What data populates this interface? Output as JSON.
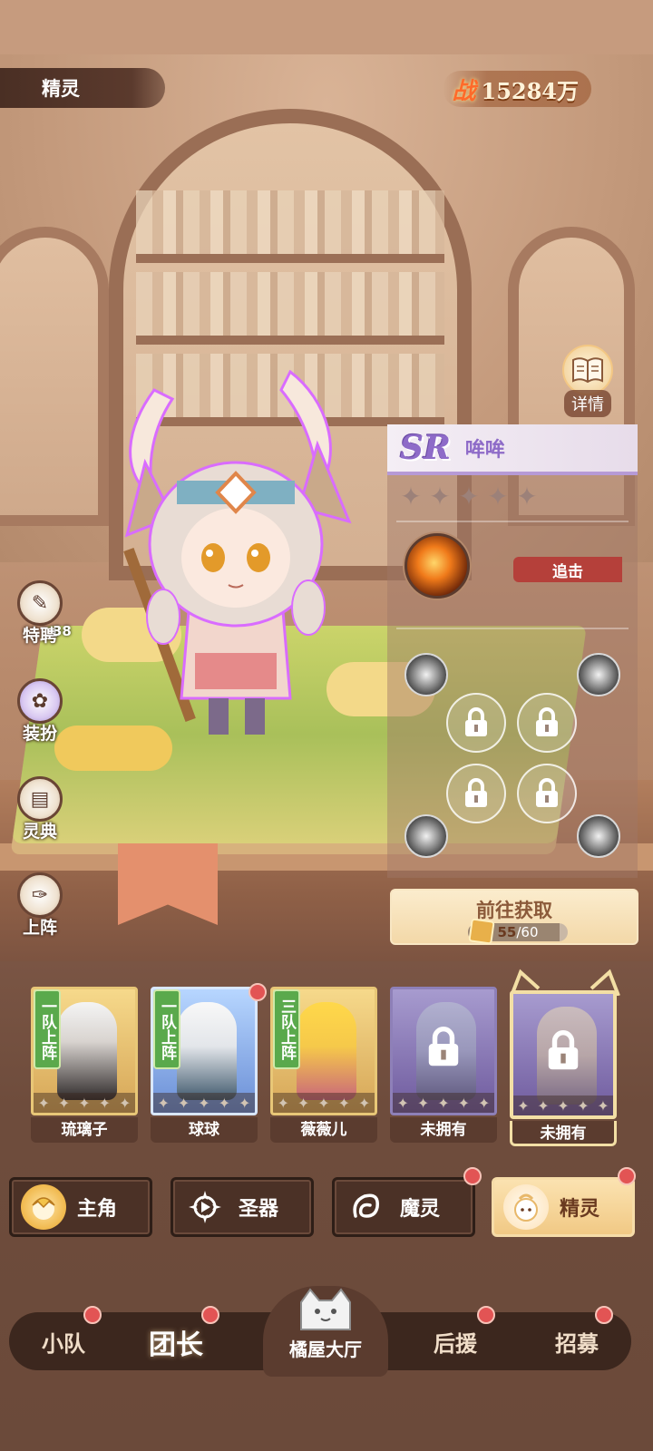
{
  "header": {
    "title": "精灵",
    "power_icon": "战",
    "power_value": "15284万"
  },
  "details_button": {
    "label": "详情",
    "icon": "book-icon"
  },
  "character": {
    "rarity": "SR",
    "name": "哞哞",
    "stars_total": 5,
    "stars_filled": 0,
    "skill": {
      "icon": "fire-meteor-icon",
      "tag": "追击"
    },
    "rune_slots_locked": 4,
    "obtain": {
      "label": "前往获取",
      "current": "55",
      "required": "/60",
      "progress": 0.9167
    }
  },
  "side_menu": [
    {
      "label": "特聘",
      "icon": "scroll-icon",
      "badge": "38"
    },
    {
      "label": "装扮",
      "icon": "outfit-icon"
    },
    {
      "label": "灵典",
      "icon": "codex-icon"
    },
    {
      "label": "上阵",
      "icon": "deploy-icon"
    }
  ],
  "roster": [
    {
      "name": "琉璃子",
      "team_tag": "一队上阵",
      "owned": true,
      "style": "gold",
      "red_dot": false
    },
    {
      "name": "球球",
      "team_tag": "一队上阵",
      "owned": true,
      "style": "blue",
      "red_dot": true
    },
    {
      "name": "薇薇儿",
      "team_tag": "三队上阵",
      "owned": true,
      "style": "gold",
      "red_dot": false
    },
    {
      "name": "未拥有",
      "team_tag": "",
      "owned": false,
      "style": "locked",
      "red_dot": false
    },
    {
      "name": "未拥有",
      "team_tag": "",
      "owned": false,
      "style": "locked",
      "red_dot": false,
      "selected": true
    }
  ],
  "categories": [
    {
      "label": "主角",
      "icon": "hero-icon",
      "active": false,
      "red_dot": false
    },
    {
      "label": "圣器",
      "icon": "artifact-icon",
      "active": false,
      "red_dot": false
    },
    {
      "label": "魔灵",
      "icon": "demon-spirit-icon",
      "active": false,
      "red_dot": true
    },
    {
      "label": "精灵",
      "icon": "sprite-icon",
      "active": true,
      "red_dot": true
    }
  ],
  "bottom_nav": {
    "items": [
      {
        "label": "小队",
        "active": false,
        "red_dot": true
      },
      {
        "label": "团长",
        "active": true,
        "red_dot": true
      },
      {
        "label": "橘屋大厅",
        "active": false,
        "red_dot": false
      },
      {
        "label": "后援",
        "active": false,
        "red_dot": true
      },
      {
        "label": "招募",
        "active": false,
        "red_dot": true
      }
    ]
  },
  "colors": {
    "rarity_purple": "#8e6bc8",
    "active_tab": "#f1c985",
    "red_dot": "#e25454",
    "team_tag_green": "#5aa94c"
  }
}
